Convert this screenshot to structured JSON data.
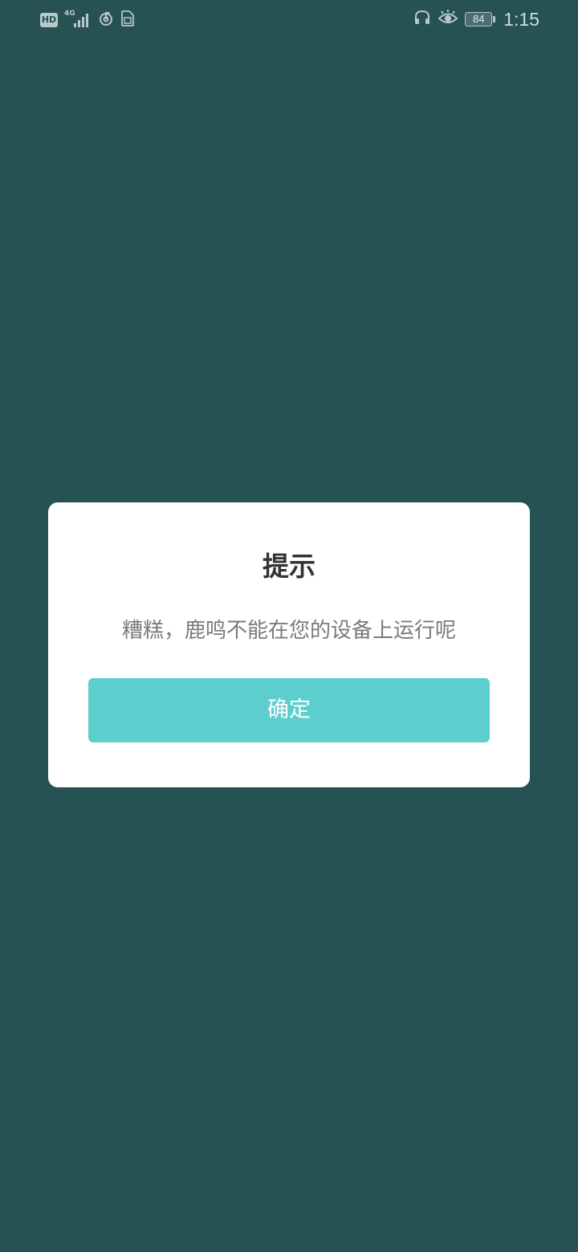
{
  "status_bar": {
    "hd_label": "HD",
    "network_type": "4G",
    "battery_level": "84",
    "time": "1:15",
    "icons": [
      "hd-icon",
      "signal-icon",
      "netease-music-icon",
      "sim-card-icon",
      "headset-icon",
      "eye-comfort-icon",
      "battery-icon"
    ]
  },
  "dialog": {
    "title": "提示",
    "message": "糟糕，鹿鸣不能在您的设备上运行呢",
    "confirm_label": "确定"
  },
  "colors": {
    "background": "#265253",
    "dialog_background": "#ffffff",
    "button": "#5ccecd",
    "title_text": "#333333",
    "message_text": "#7a7a7a"
  }
}
